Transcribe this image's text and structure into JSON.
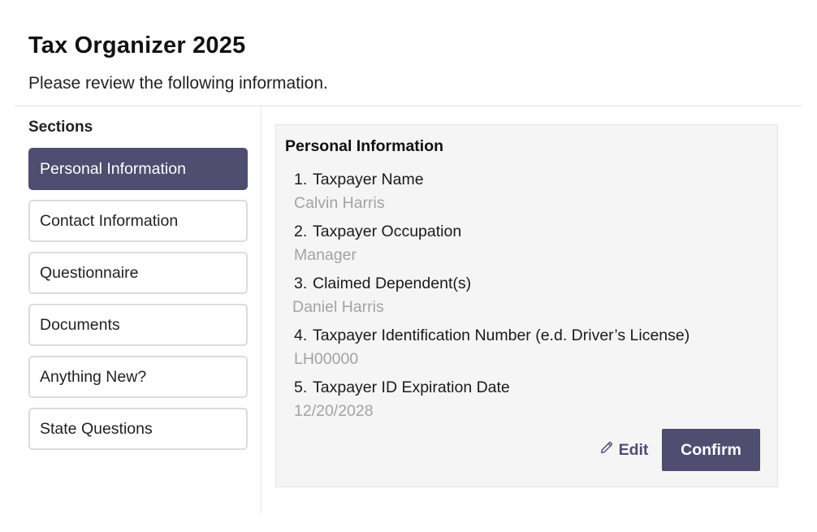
{
  "header": {
    "title": "Tax Organizer 2025",
    "subtitle": "Please review the following information."
  },
  "sidebar": {
    "heading": "Sections",
    "active_index": 0,
    "items": [
      {
        "label": "Personal Information"
      },
      {
        "label": "Contact Information"
      },
      {
        "label": "Questionnaire"
      },
      {
        "label": "Documents"
      },
      {
        "label": "Anything New?"
      },
      {
        "label": "State Questions"
      }
    ]
  },
  "panel": {
    "title": "Personal Information",
    "fields": [
      {
        "number": "1.",
        "label": "Taxpayer Name",
        "value": "Calvin Harris"
      },
      {
        "number": "2.",
        "label": "Taxpayer Occupation",
        "value": "Manager"
      },
      {
        "number": "3.",
        "label": "Claimed Dependent(s)",
        "value": "Daniel Harris"
      },
      {
        "number": "4.",
        "label": "Taxpayer Identification Number (e.d. Driver’s License)",
        "value": "LH00000"
      },
      {
        "number": "5.",
        "label": "Taxpayer ID Expiration Date",
        "value": "12/20/2028"
      }
    ],
    "actions": {
      "edit_label": "Edit",
      "confirm_label": "Confirm"
    }
  },
  "colors": {
    "accent": "#4f4d70",
    "muted_text": "#a3a3a3",
    "panel_bg": "#f5f5f5",
    "border": "#dcdcdc"
  },
  "icons": {
    "edit": "pencil-icon"
  }
}
